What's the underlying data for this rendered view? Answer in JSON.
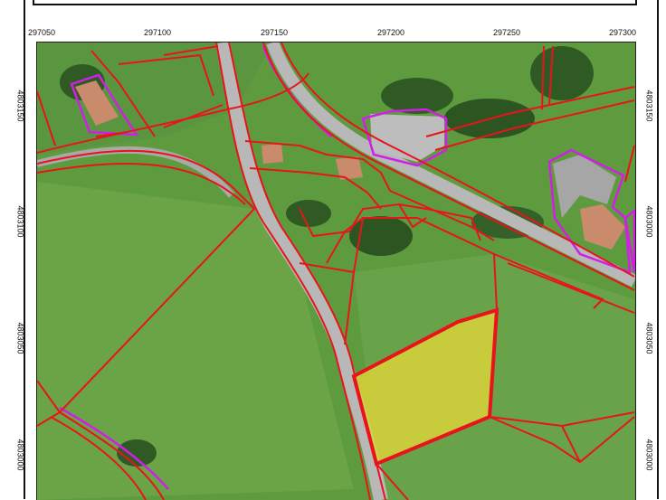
{
  "x_ticks": [
    "297050",
    "297100",
    "297150",
    "297200",
    "297250",
    "297300"
  ],
  "y_ticks_left": [
    "4803150",
    "4803100",
    "4803050",
    "4803000"
  ],
  "y_ticks_right": [
    "4803150",
    "4803000",
    "4803050",
    "4803000"
  ],
  "colors": {
    "parcel_line": "#e8141c",
    "building_outline": "#d21ee6",
    "highlighted_parcel": "#d9d238",
    "grass": "#5e9b3e",
    "road": "#b8b8b8"
  }
}
